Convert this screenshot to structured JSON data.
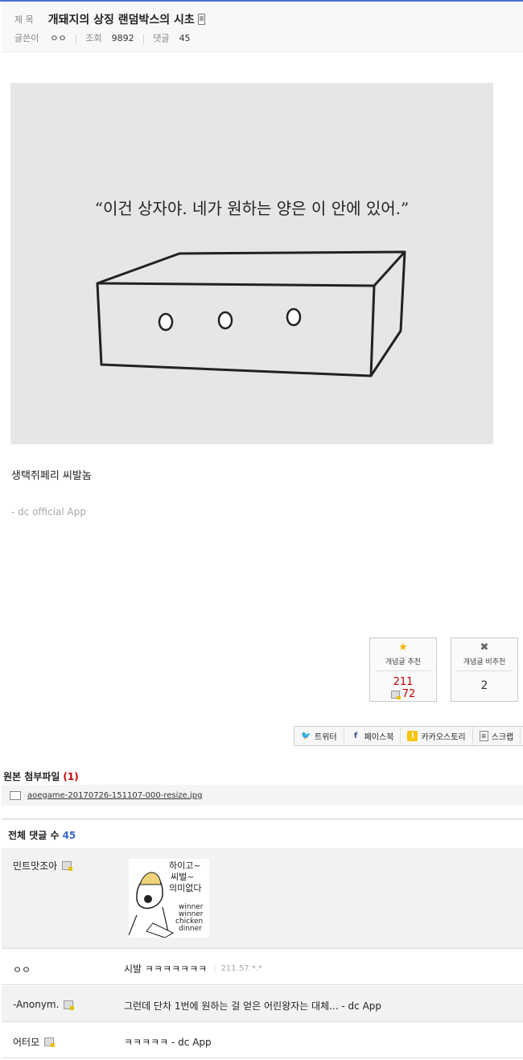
{
  "header": {
    "title_label": "제 목",
    "title": "개돼지의 상징 랜덤박스의 시초",
    "writer_label": "글쓴이",
    "writer": "ㅇㅇ",
    "views_label": "조회",
    "views": "9892",
    "comments_label": "댓글",
    "comments": "45"
  },
  "post": {
    "image_quote": "“이건 상자야. 네가 원하는 양은 이 안에 있어.”",
    "body_text": "생택쥐페리 씨발놈",
    "app_signature": "- dc official App"
  },
  "votes": {
    "up_label": "개념글 추천",
    "up_count": "211",
    "up_fixed_count": "72",
    "down_label": "개념글 비추천",
    "down_count": "2"
  },
  "share": {
    "twitter": "트위터",
    "facebook": "페이스북",
    "kakao": "카카오스토리",
    "scrap": "스크랩"
  },
  "attachments": {
    "title": "원본 첨부파일",
    "count": "(1)",
    "file": "aoegame-20170726-151107-000-resize.jpg"
  },
  "comments_section": {
    "title": "전체 댓글 수",
    "count": "45",
    "items": [
      {
        "nick": "민트맛조아",
        "body": "",
        "dccon_lines": [
          "하이고~",
          "씨벌~",
          "의미없다",
          "winner",
          "winner",
          "chicken",
          "dinner"
        ]
      },
      {
        "nick": "ㅇㅇ",
        "body": "시발 ㅋㅋㅋㅋㅋㅋㅋ",
        "ip": "211.57.*.*"
      },
      {
        "nick": "-Anonym.",
        "body": "그런데 단차 1번에 원하는 걸 얻은 어린왕자는 대체... - dc App"
      },
      {
        "nick": "어터모",
        "body": "ㅋㅋㅋㅋㅋ - dc App"
      }
    ]
  }
}
